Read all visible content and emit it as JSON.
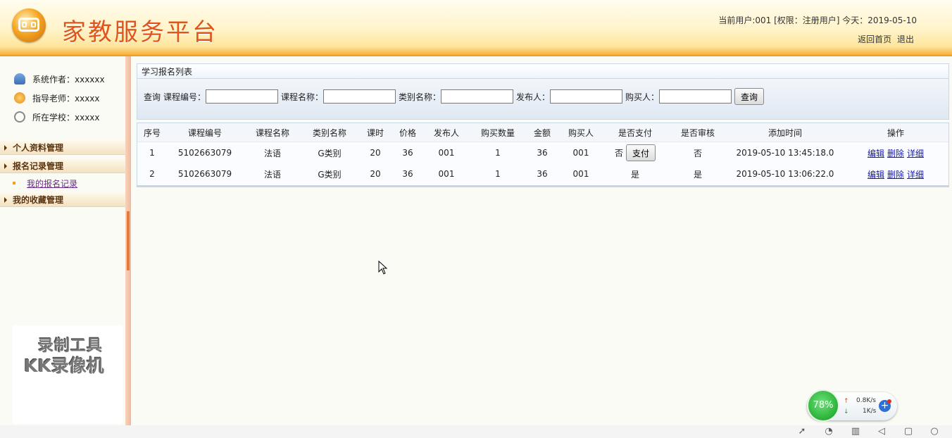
{
  "header": {
    "title": "家教服务平台",
    "user_info": "当前用户:001 [权限：注册用户] 今天：2019-05-10",
    "links": [
      "返回首页",
      "退出"
    ]
  },
  "sidebar": {
    "info": [
      {
        "icon": "user-icon",
        "text": "系统作者：xxxxxx"
      },
      {
        "icon": "teacher-icon",
        "text": "指导老师：xxxxx"
      },
      {
        "icon": "school-icon",
        "text": "所在学校：xxxxx"
      }
    ],
    "menu": [
      {
        "label": "个人资料管理"
      },
      {
        "label": "报名记录管理",
        "sub": "我的报名记录"
      },
      {
        "label": "我的收藏管理"
      }
    ]
  },
  "watermark": {
    "line1": "录制工具",
    "line2": "KK录像机"
  },
  "panel": {
    "title": "学习报名列表",
    "search": {
      "prefix": "查询",
      "labels": [
        "课程编号：",
        "课程名称：",
        "类别名称：",
        "发布人：",
        "购买人："
      ],
      "button": "查询"
    }
  },
  "table": {
    "headers": [
      "序号",
      "课程编号",
      "课程名称",
      "类别名称",
      "课时",
      "价格",
      "发布人",
      "购买数量",
      "金额",
      "购买人",
      "是否支付",
      "是否审核",
      "添加时间",
      "操作"
    ],
    "rows": [
      {
        "no": "1",
        "code": "5102663079",
        "name": "法语",
        "category": "G类别",
        "hours": "20",
        "price": "36",
        "publisher": "001",
        "qty": "1",
        "amount": "36",
        "buyer": "001",
        "paid": "否",
        "pay_btn": "支付",
        "audited": "否",
        "time": "2019-05-10 13:45:18.0"
      },
      {
        "no": "2",
        "code": "5102663079",
        "name": "法语",
        "category": "G类别",
        "hours": "20",
        "price": "36",
        "publisher": "001",
        "qty": "1",
        "amount": "36",
        "buyer": "001",
        "paid": "是",
        "audited": "是",
        "time": "2019-05-10 13:06:22.0"
      }
    ],
    "ops": [
      "编辑",
      "删除",
      "详细"
    ]
  },
  "net_widget": {
    "percent": "78%",
    "up": "0.8K/s",
    "down": "1K/s"
  },
  "colors": {
    "accent": "#e0561a",
    "header_bottom": "#f7b03a",
    "link": "#1a1aa8"
  }
}
